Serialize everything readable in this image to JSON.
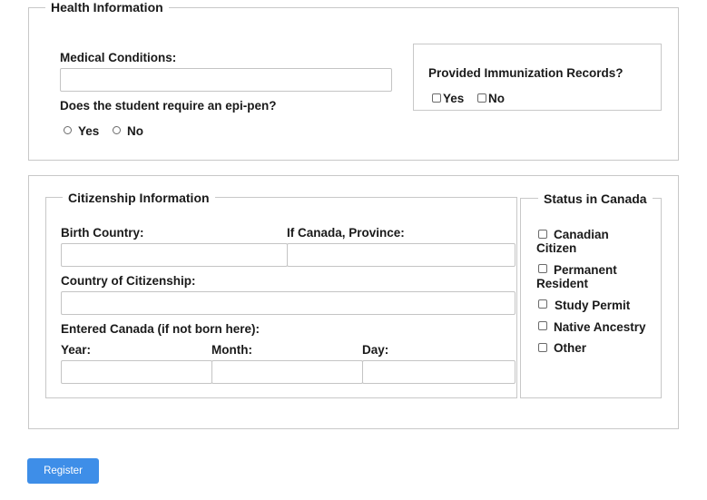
{
  "health": {
    "legend": "Health Information",
    "medical_label": "Medical Conditions:",
    "medical_value": "",
    "epipen_question": "Does the student require an epi-pen?",
    "epipen_yes": "Yes",
    "epipen_no": "No",
    "immunization_question": "Provided Immunization Records?",
    "immunization_yes": "Yes",
    "immunization_no": "No"
  },
  "citizenship": {
    "legend": "Citizenship Information",
    "birth_country_label": "Birth Country:",
    "province_label": "If Canada, Province:",
    "country_citizenship_label": "Country of Citizenship:",
    "entered_label": "Entered Canada (if not born here):",
    "year_label": "Year:",
    "month_label": "Month:",
    "day_label": "Day:"
  },
  "status": {
    "legend": "Status in Canada",
    "options": [
      {
        "line1": "Canadian",
        "line2": "Citizen"
      },
      {
        "line1": "Permanent",
        "line2": "Resident"
      },
      {
        "line1": "Study Permit",
        "line2": ""
      },
      {
        "line1": "Native Ancestry",
        "line2": ""
      },
      {
        "line1": "Other",
        "line2": ""
      }
    ]
  },
  "actions": {
    "register_label": "Register",
    "button_color": "#3e8ee8"
  }
}
